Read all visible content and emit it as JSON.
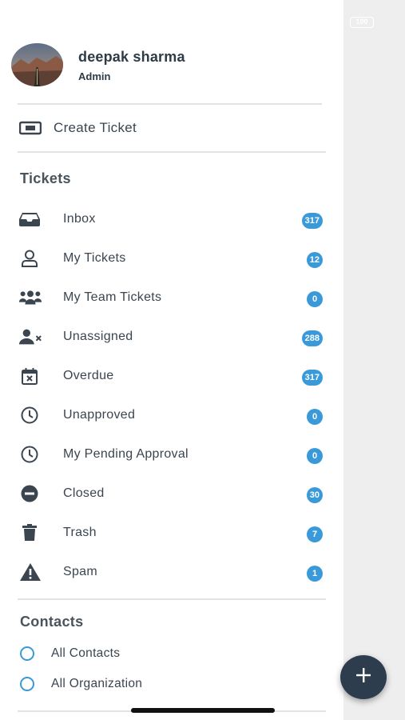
{
  "status_bar": {
    "battery": "100"
  },
  "user": {
    "name": "deepak sharma",
    "role": "Admin"
  },
  "create_ticket": {
    "label": "Create Ticket",
    "icon": "ticket-icon"
  },
  "tickets": {
    "heading": "Tickets",
    "items": [
      {
        "label": "Inbox",
        "count": "317",
        "icon": "inbox-icon"
      },
      {
        "label": "My Tickets",
        "count": "12",
        "icon": "user-icon"
      },
      {
        "label": "My Team Tickets",
        "count": "0",
        "icon": "users-icon"
      },
      {
        "label": "Unassigned",
        "count": "288",
        "icon": "user-x-icon"
      },
      {
        "label": "Overdue",
        "count": "317",
        "icon": "calendar-x-icon"
      },
      {
        "label": "Unapproved",
        "count": "0",
        "icon": "clock-icon"
      },
      {
        "label": "My Pending Approval",
        "count": "0",
        "icon": "clock-icon"
      },
      {
        "label": "Closed",
        "count": "30",
        "icon": "minus-circle-icon"
      },
      {
        "label": "Trash",
        "count": "7",
        "icon": "trash-icon"
      },
      {
        "label": "Spam",
        "count": "1",
        "icon": "warning-icon"
      }
    ]
  },
  "contacts": {
    "heading": "Contacts",
    "items": [
      {
        "label": "All Contacts",
        "icon": "circle-icon"
      },
      {
        "label": "All Organization",
        "icon": "circle-icon"
      }
    ]
  },
  "fab": {
    "icon": "plus-icon"
  },
  "colors": {
    "badge": "#3a9ad9",
    "fab": "#2e3d4e",
    "text": "#3a4550",
    "accent_ring": "#3a9ad9"
  }
}
